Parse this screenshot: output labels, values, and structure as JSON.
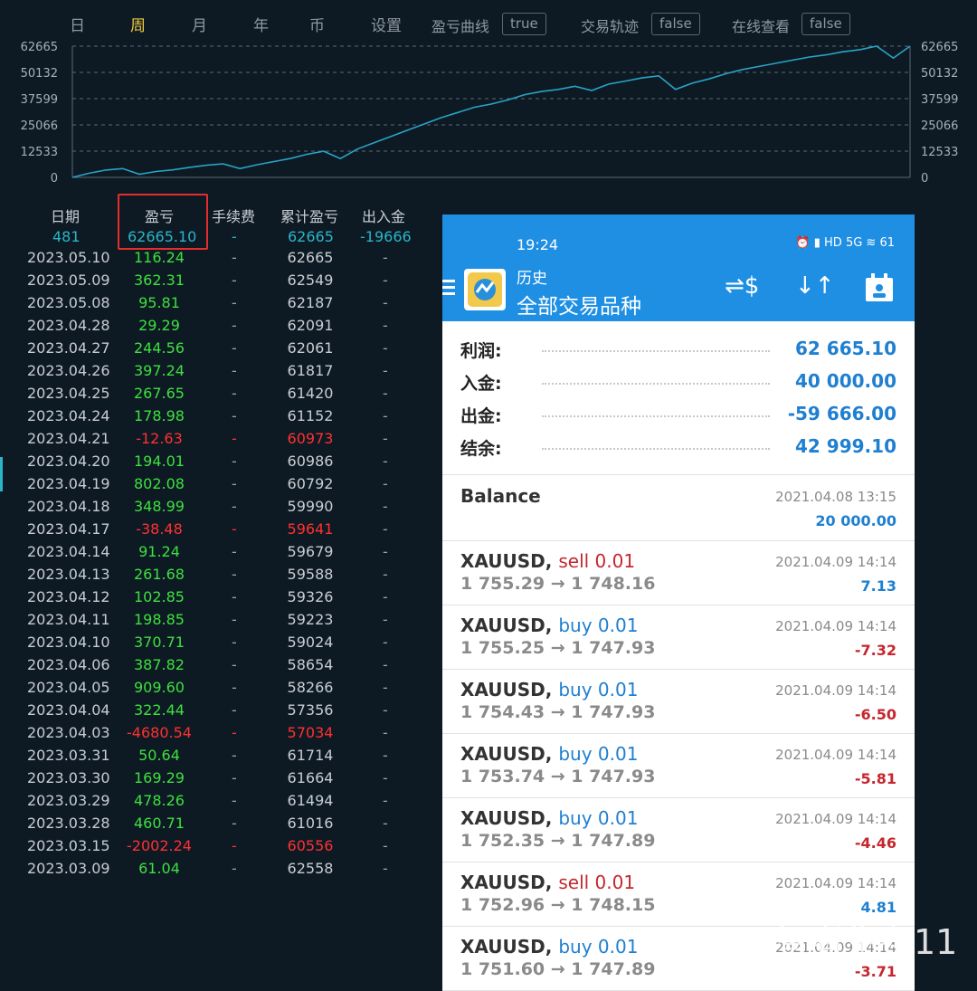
{
  "tabs": [
    "日",
    "周",
    "月",
    "年",
    "币",
    "设置"
  ],
  "active_tab": "周",
  "options": [
    {
      "label": "盈亏曲线",
      "value": "true"
    },
    {
      "label": "交易轨迹",
      "value": "false"
    },
    {
      "label": "在线查看",
      "value": "false"
    }
  ],
  "chart_data": {
    "type": "line",
    "y_ticks": [
      "62665",
      "50132",
      "37599",
      "25066",
      "12533",
      "0"
    ],
    "ylim": [
      0,
      62665
    ],
    "grid": true,
    "line_color": "#29a3c6",
    "series": [
      {
        "x": [
          0,
          1,
          2,
          3,
          4,
          5,
          6,
          7,
          8,
          9,
          10,
          11,
          12,
          13,
          14,
          15,
          16,
          17,
          18,
          19,
          20,
          21,
          22,
          23,
          24,
          25,
          26,
          27,
          28,
          29,
          30,
          31,
          32,
          33,
          34,
          35,
          36,
          37,
          38,
          39,
          40,
          41,
          42,
          43,
          44,
          45,
          46,
          47,
          48,
          49,
          50
        ],
        "values": [
          0,
          2000,
          3500,
          4200,
          1500,
          2800,
          3600,
          4800,
          5800,
          6500,
          4200,
          6000,
          7500,
          9000,
          11000,
          12500,
          9000,
          13500,
          16500,
          19500,
          22500,
          25500,
          28500,
          31000,
          33500,
          35000,
          37000,
          39500,
          41000,
          42000,
          43500,
          41500,
          44500,
          46000,
          47500,
          48500,
          42000,
          45000,
          47000,
          49500,
          51500,
          53000,
          54500,
          56000,
          57500,
          58500,
          60000,
          61000,
          62665,
          57000,
          62665
        ]
      }
    ]
  },
  "table": {
    "headers": {
      "date": "日期",
      "pl": "盈亏",
      "fee": "手续费",
      "cum": "累计盈亏",
      "io": "出入金"
    },
    "summary": {
      "date": "481",
      "pl": "62665.10",
      "fee": "-",
      "cum": "62665",
      "io": "-19666"
    },
    "rows": [
      {
        "date": "2023.05.10",
        "pl": "116.24",
        "fee": "-",
        "cum": "62665",
        "io": "-",
        "color": "green"
      },
      {
        "date": "2023.05.09",
        "pl": "362.31",
        "fee": "-",
        "cum": "62549",
        "io": "-",
        "color": "green"
      },
      {
        "date": "2023.05.08",
        "pl": "95.81",
        "fee": "-",
        "cum": "62187",
        "io": "-",
        "color": "green"
      },
      {
        "date": "2023.04.28",
        "pl": "29.29",
        "fee": "-",
        "cum": "62091",
        "io": "-",
        "color": "green"
      },
      {
        "date": "2023.04.27",
        "pl": "244.56",
        "fee": "-",
        "cum": "62061",
        "io": "-",
        "color": "green"
      },
      {
        "date": "2023.04.26",
        "pl": "397.24",
        "fee": "-",
        "cum": "61817",
        "io": "-",
        "color": "green"
      },
      {
        "date": "2023.04.25",
        "pl": "267.65",
        "fee": "-",
        "cum": "61420",
        "io": "-",
        "color": "green"
      },
      {
        "date": "2023.04.24",
        "pl": "178.98",
        "fee": "-",
        "cum": "61152",
        "io": "-",
        "color": "green"
      },
      {
        "date": "2023.04.21",
        "pl": "-12.63",
        "fee": "-",
        "cum": "60973",
        "io": "-",
        "color": "red"
      },
      {
        "date": "2023.04.20",
        "pl": "194.01",
        "fee": "-",
        "cum": "60986",
        "io": "-",
        "color": "green"
      },
      {
        "date": "2023.04.19",
        "pl": "802.08",
        "fee": "-",
        "cum": "60792",
        "io": "-",
        "color": "green"
      },
      {
        "date": "2023.04.18",
        "pl": "348.99",
        "fee": "-",
        "cum": "59990",
        "io": "-",
        "color": "green"
      },
      {
        "date": "2023.04.17",
        "pl": "-38.48",
        "fee": "-",
        "cum": "59641",
        "io": "-",
        "color": "red"
      },
      {
        "date": "2023.04.14",
        "pl": "91.24",
        "fee": "-",
        "cum": "59679",
        "io": "-",
        "color": "green"
      },
      {
        "date": "2023.04.13",
        "pl": "261.68",
        "fee": "-",
        "cum": "59588",
        "io": "-",
        "color": "green"
      },
      {
        "date": "2023.04.12",
        "pl": "102.85",
        "fee": "-",
        "cum": "59326",
        "io": "-",
        "color": "green"
      },
      {
        "date": "2023.04.11",
        "pl": "198.85",
        "fee": "-",
        "cum": "59223",
        "io": "-",
        "color": "green"
      },
      {
        "date": "2023.04.10",
        "pl": "370.71",
        "fee": "-",
        "cum": "59024",
        "io": "-",
        "color": "green"
      },
      {
        "date": "2023.04.06",
        "pl": "387.82",
        "fee": "-",
        "cum": "58654",
        "io": "-",
        "color": "green"
      },
      {
        "date": "2023.04.05",
        "pl": "909.60",
        "fee": "-",
        "cum": "58266",
        "io": "-",
        "color": "green"
      },
      {
        "date": "2023.04.04",
        "pl": "322.44",
        "fee": "-",
        "cum": "57356",
        "io": "-",
        "color": "green"
      },
      {
        "date": "2023.04.03",
        "pl": "-4680.54",
        "fee": "-",
        "cum": "57034",
        "io": "-",
        "color": "red"
      },
      {
        "date": "2023.03.31",
        "pl": "50.64",
        "fee": "-",
        "cum": "61714",
        "io": "-",
        "color": "green"
      },
      {
        "date": "2023.03.30",
        "pl": "169.29",
        "fee": "-",
        "cum": "61664",
        "io": "-",
        "color": "green"
      },
      {
        "date": "2023.03.29",
        "pl": "478.26",
        "fee": "-",
        "cum": "61494",
        "io": "-",
        "color": "green"
      },
      {
        "date": "2023.03.28",
        "pl": "460.71",
        "fee": "-",
        "cum": "61016",
        "io": "-",
        "color": "green"
      },
      {
        "date": "2023.03.15",
        "pl": "-2002.24",
        "fee": "-",
        "cum": "60556",
        "io": "-",
        "color": "red"
      },
      {
        "date": "2023.03.09",
        "pl": "61.04",
        "fee": "-",
        "cum": "62558",
        "io": "-",
        "color": "green"
      }
    ]
  },
  "phone": {
    "status_time": "19:24",
    "status_icons": "⏰ ▮ HD 5G ≋ 61",
    "header_small": "历史",
    "header_big": "全部交易品种",
    "summary": [
      {
        "label": "利润:",
        "value": "62 665.10"
      },
      {
        "label": "入金:",
        "value": "40 000.00"
      },
      {
        "label": "出金:",
        "value": "-59 666.00"
      },
      {
        "label": "结余:",
        "value": "42 999.10"
      }
    ],
    "balance": {
      "label": "Balance",
      "time": "2021.04.08 13:15",
      "value": "20 000.00"
    },
    "trades": [
      {
        "symbol": "XAUUSD,",
        "side": "sell 0.01",
        "dir": "sell",
        "prices": "1 755.29 → 1 748.16",
        "time": "2021.04.09 14:14",
        "pl": "7.13",
        "sign": "pos"
      },
      {
        "symbol": "XAUUSD,",
        "side": "buy 0.01",
        "dir": "buy",
        "prices": "1 755.25 → 1 747.93",
        "time": "2021.04.09 14:14",
        "pl": "-7.32",
        "sign": "neg"
      },
      {
        "symbol": "XAUUSD,",
        "side": "buy 0.01",
        "dir": "buy",
        "prices": "1 754.43 → 1 747.93",
        "time": "2021.04.09 14:14",
        "pl": "-6.50",
        "sign": "neg"
      },
      {
        "symbol": "XAUUSD,",
        "side": "buy 0.01",
        "dir": "buy",
        "prices": "1 753.74 → 1 747.93",
        "time": "2021.04.09 14:14",
        "pl": "-5.81",
        "sign": "neg"
      },
      {
        "symbol": "XAUUSD,",
        "side": "buy 0.01",
        "dir": "buy",
        "prices": "1 752.35 → 1 747.89",
        "time": "2021.04.09 14:14",
        "pl": "-4.46",
        "sign": "neg"
      },
      {
        "symbol": "XAUUSD,",
        "side": "sell 0.01",
        "dir": "sell",
        "prices": "1 752.96 → 1 748.15",
        "time": "2021.04.09 14:14",
        "pl": "4.81",
        "sign": "pos"
      },
      {
        "symbol": "XAUUSD,",
        "side": "buy 0.01",
        "dir": "buy",
        "prices": "1 751.60 → 1 747.89",
        "time": "2021.04.09 14:14",
        "pl": "-3.71",
        "sign": "neg"
      }
    ]
  },
  "watermark": "@智者生存11"
}
